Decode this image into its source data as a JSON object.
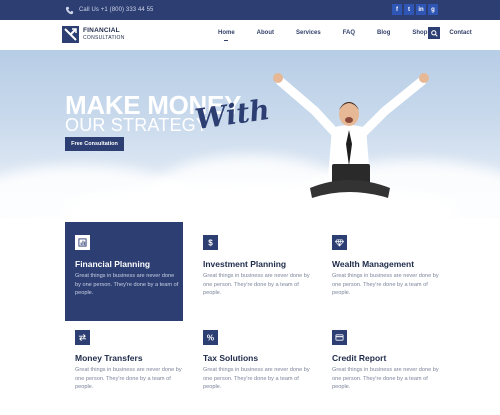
{
  "topbar": {
    "phone": "Call Us +1 (800) 333 44 55",
    "social_icons": [
      "f",
      "t",
      "in",
      "g"
    ]
  },
  "nav": {
    "logo_line1": "FINANCIAL",
    "logo_line2": "CONSULTATION",
    "items": [
      "Home",
      "About",
      "Services",
      "FAQ",
      "Blog",
      "Shop",
      "Contact"
    ],
    "active": "Home"
  },
  "hero": {
    "title1": "MAKE MONEY",
    "script": "With",
    "title2": "OUR STRATEGY",
    "button": "Free Consultation"
  },
  "services": [
    {
      "title": "Financial Planning",
      "icon": "chart-icon",
      "text": "Great things in business are never done by one person. They're done by a team of people."
    },
    {
      "title": "Investment Planning",
      "icon": "dollar-icon",
      "text": "Great things in business are never done by one person. They're done by a team of people."
    },
    {
      "title": "Wealth Management",
      "icon": "diamond-icon",
      "text": "Great things in business are never done by one person. They're done by a team of people."
    },
    {
      "title": "Money Transfers",
      "icon": "transfer-icon",
      "text": "Great things in business are never done by one person. They're done by a team of people."
    },
    {
      "title": "Tax Solutions",
      "icon": "percent-icon",
      "text": "Great things in business are never done by one person. They're done by a team of people."
    },
    {
      "title": "Credit Report",
      "icon": "card-icon",
      "text": "Great things in business are never done by one person. They're done by a team of people."
    }
  ],
  "colors": {
    "primary": "#2c3e72",
    "social": "#2f56b5",
    "text": "#1e2a4a",
    "muted": "#7b849a"
  }
}
